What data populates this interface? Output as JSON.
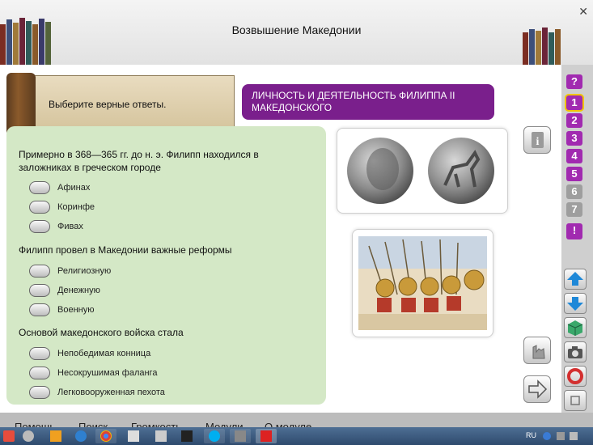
{
  "window": {
    "title": "Возвышение Македонии"
  },
  "instruction": "Выберите верные ответы.",
  "topic": "ЛИЧНОСТЬ И ДЕЯТЕЛЬНОСТЬ ФИЛИППА II МАКЕДОНСКОГО",
  "questions": [
    {
      "text": "Примерно в 368—365 гг. до н. э. Филипп находился в заложниках в греческом городе",
      "options": [
        "Афинах",
        "Коринфе",
        "Фивах"
      ]
    },
    {
      "text": "Филипп провел в Македонии важные реформы",
      "options": [
        "Религиозную",
        "Денежную",
        "Военную"
      ]
    },
    {
      "text": "Основой македонского войска стала",
      "options": [
        "Непобедимая конница",
        "Несокрушимая фаланга",
        "Легковооруженная пехота"
      ]
    }
  ],
  "side_buttons": {
    "info": "i"
  },
  "rail": {
    "help": "?",
    "numbers": [
      "1",
      "2",
      "3",
      "4",
      "5",
      "6",
      "7"
    ],
    "alert": "!"
  },
  "menu": [
    "Помощь",
    "Поиск",
    "Громкость",
    "Модули",
    "О модуле"
  ],
  "taskbar": {
    "lang": "RU"
  },
  "colors": {
    "accent_purple": "#7a1f8c",
    "panel_green": "#d4e8c6",
    "rail_purple": "#a12ab0",
    "rail_gray": "#9e9e9e"
  }
}
